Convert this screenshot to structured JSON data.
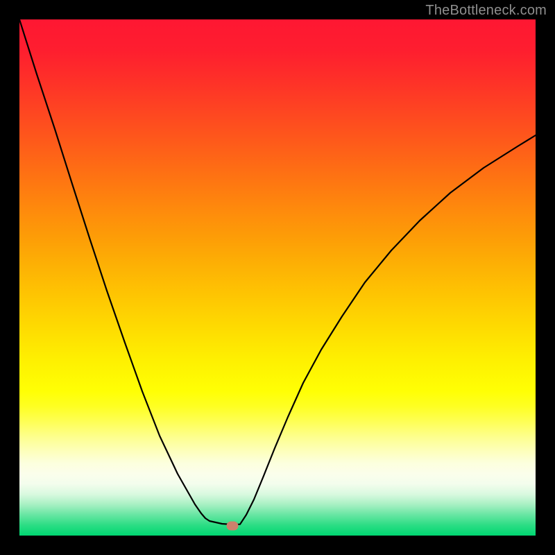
{
  "watermark": "TheBottleneck.com",
  "chart_data": {
    "type": "line",
    "title": "",
    "xlabel": "",
    "ylabel": "",
    "x_range_fraction": [
      0,
      1
    ],
    "y_range_fraction": [
      0,
      1
    ],
    "note": "No axes or tick labels are drawn; values are fractions of the plot area (0 at left/top, 1 at right/bottom).",
    "series": [
      {
        "name": "left-branch",
        "x": [
          0.0,
          0.034,
          0.068,
          0.102,
          0.136,
          0.17,
          0.204,
          0.238,
          0.272,
          0.306,
          0.34,
          0.352,
          0.36,
          0.368
        ],
        "y": [
          0.0,
          0.107,
          0.213,
          0.319,
          0.424,
          0.526,
          0.626,
          0.72,
          0.806,
          0.881,
          0.94,
          0.957,
          0.966,
          0.972
        ]
      },
      {
        "name": "valley-flat",
        "x": [
          0.368,
          0.38,
          0.392,
          0.404,
          0.416,
          0.428
        ],
        "y": [
          0.972,
          0.975,
          0.977,
          0.978,
          0.978,
          0.978
        ]
      },
      {
        "name": "right-branch",
        "x": [
          0.428,
          0.44,
          0.455,
          0.473,
          0.494,
          0.52,
          0.55,
          0.585,
          0.625,
          0.67,
          0.72,
          0.775,
          0.835,
          0.9,
          0.965,
          1.0
        ],
        "y": [
          0.978,
          0.96,
          0.93,
          0.885,
          0.83,
          0.77,
          0.705,
          0.64,
          0.575,
          0.51,
          0.448,
          0.39,
          0.336,
          0.287,
          0.245,
          0.225
        ]
      }
    ],
    "marker": {
      "x_fraction": 0.414,
      "y_fraction": 0.982,
      "color": "#cc816c"
    },
    "background_gradient_stops": [
      {
        "pos": 0.0,
        "color": "#fe1732"
      },
      {
        "pos": 0.5,
        "color": "#fec702"
      },
      {
        "pos": 0.72,
        "color": "#ffff04"
      },
      {
        "pos": 0.86,
        "color": "#fcffde"
      },
      {
        "pos": 1.0,
        "color": "#00d772"
      }
    ]
  }
}
